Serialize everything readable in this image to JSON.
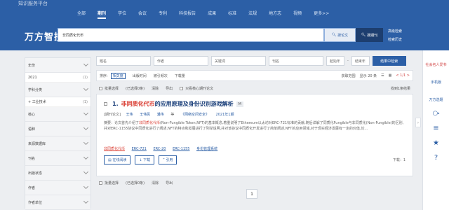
{
  "header": {
    "top_logo": "知识服务平台",
    "nav": [
      "全部",
      "期刊",
      "学位",
      "会议",
      "专利",
      "科技报告",
      "成果",
      "标准",
      "法规",
      "地方志",
      "视频",
      "更多>>"
    ],
    "active_nav": "期刊"
  },
  "search": {
    "brand": "万方智搜",
    "query": "非同质化代币",
    "btn_paper": "搜论文",
    "btn_journal": "搜期刊",
    "adv1": "高级检索",
    "adv2": "检索历史"
  },
  "sidebar": {
    "facet_year": "年份",
    "year_value": "2021",
    "year_count": "(1)",
    "facet_subject": "学科分类",
    "subject_value": "+ 工业技术",
    "subject_count": "(1)",
    "facet_core": "核心",
    "facet_language": "语种",
    "facet_source": "来源数据库",
    "facet_journal": "刊名",
    "facet_status": "出版状态",
    "facet_author": "作者",
    "facet_org": "作者单位"
  },
  "filters": {
    "title": "题名",
    "author": "作者",
    "keyword": "关键词",
    "journal": "刊名",
    "year_start": "起始年",
    "dash": "-",
    "year_end": "结束年",
    "btn": "结果中检索"
  },
  "sortbar": {
    "label": "排序:",
    "relevance": "相关度",
    "pubtime": "出版时间",
    "cited": "被引频次",
    "downloads": "下载量",
    "fulltext": "获取范围",
    "show": "显示 20 条",
    "pager": "< 1/1 >"
  },
  "selectbar": {
    "select_all": "批量选择",
    "selected": "(已选择0条)",
    "clear": "清除",
    "export": "导出",
    "core_only": "只看核心期刊论文",
    "found": "找到1条结果"
  },
  "result": {
    "index": "1.",
    "title_hl": "非同质化代币",
    "title_rest": "的应用原理及身份识别游戏解析",
    "tag": "M",
    "meta_type": "[期刊论文]",
    "meta_author1": "王伟",
    "meta_author2": "王伟民",
    "meta_author3": "潘伟",
    "meta_author4": "等",
    "meta_journal": "《网络空间安全》",
    "meta_issue": "2021年1期",
    "abstract_pre": "摘要：论文首先介绍了",
    "abstract_hl": "非同质化代币",
    "abstract_rest": "(Non-Fungible Token,NFT)的基本概念,着重说明了Ethereum以太坊对ERC-721标准的贡献,随后详解了同质化Fungible与非同质化(Non-Fungible)的区别,并对ERC-1155协议中同质化进行了阐述,NFT的特点和发展进行了列举说明,并对该协议中同质化开发进行了简单阐述,NFT的应用领域,对于现实经济发展有一定的价值,论...",
    "kw1": "非同质化代币",
    "kw2": "ERC-721",
    "kw3": "ERC-20",
    "kw4": "ERC-1155",
    "kw5": "身份管理系统",
    "btn_read": "在线阅读",
    "btn_download": "下载",
    "btn_cite": "引用",
    "download_count": "下载：1"
  },
  "bottombar": {
    "select_all": "批量选择",
    "selected": "(已选择0条)",
    "clear": "清除",
    "export": "导出",
    "page": "1"
  },
  "rightpanel": {
    "item1": "社会名人爱书",
    "item2": "手机版",
    "item3": "万方选题"
  }
}
